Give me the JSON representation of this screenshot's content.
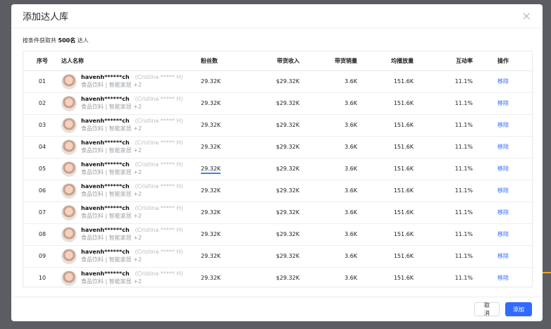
{
  "dialog": {
    "title": "添加达人库",
    "close_glyph": "×",
    "summary_prefix": "按条件获取共",
    "summary_count": "500名",
    "summary_suffix": "达人"
  },
  "table": {
    "headers": {
      "index": "序号",
      "name": "达人名称",
      "followers": "粉丝数",
      "sales_income": "带货收入",
      "sales_volume": "带货销量",
      "avg_plays": "均播放量",
      "engagement": "互动率",
      "action": "操作"
    },
    "rows": [
      {
        "index": "01",
        "handle": "havenh******ch",
        "real_name": "(Cristina ***** H)",
        "tags": "食品饮料 | 智能家居 +2",
        "followers": "29.32K",
        "income": "$29.32K",
        "volume": "3.6K",
        "plays": "151.6K",
        "rate": "11.1%",
        "action": "移除"
      },
      {
        "index": "02",
        "handle": "havenh******ch",
        "real_name": "(Cristina ***** H)",
        "tags": "食品饮料 | 智能家居 +2",
        "followers": "29.32K",
        "income": "$29.32K",
        "volume": "3.6K",
        "plays": "151.6K",
        "rate": "11.1%",
        "action": "移除"
      },
      {
        "index": "03",
        "handle": "havenh******ch",
        "real_name": "(Cristina ***** H)",
        "tags": "食品饮料 | 智能家居 +2",
        "followers": "29.32K",
        "income": "$29.32K",
        "volume": "3.6K",
        "plays": "151.6K",
        "rate": "11.1%",
        "action": "移除"
      },
      {
        "index": "04",
        "handle": "havenh******ch",
        "real_name": "(Cristina ***** H)",
        "tags": "食品饮料 | 智能家居 +2",
        "followers": "29.32K",
        "income": "$29.32K",
        "volume": "3.6K",
        "plays": "151.6K",
        "rate": "11.1%",
        "action": "移除"
      },
      {
        "index": "05",
        "handle": "havenh******ch",
        "real_name": "(Cristina ***** H)",
        "tags": "食品饮料 | 智能家居 +2",
        "followers": "29.32K",
        "income": "$29.32K",
        "volume": "3.6K",
        "plays": "151.6K",
        "rate": "11.1%",
        "action": "移除"
      },
      {
        "index": "06",
        "handle": "havenh******ch",
        "real_name": "(Cristina ***** H)",
        "tags": "食品饮料 | 智能家居 +2",
        "followers": "29.32K",
        "income": "$29.32K",
        "volume": "3.6K",
        "plays": "151.6K",
        "rate": "11.1%",
        "action": "移除"
      },
      {
        "index": "07",
        "handle": "havenh******ch",
        "real_name": "(Cristina ***** H)",
        "tags": "食品饮料 | 智能家居 +2",
        "followers": "29.32K",
        "income": "$29.32K",
        "volume": "3.6K",
        "plays": "151.6K",
        "rate": "11.1%",
        "action": "移除"
      },
      {
        "index": "08",
        "handle": "havenh******ch",
        "real_name": "(Cristina ***** H)",
        "tags": "食品饮料 | 智能家居 +2",
        "followers": "29.32K",
        "income": "$29.32K",
        "volume": "3.6K",
        "plays": "151.6K",
        "rate": "11.1%",
        "action": "移除"
      },
      {
        "index": "09",
        "handle": "havenh******ch",
        "real_name": "(Cristina ***** H)",
        "tags": "食品饮料 | 智能家居 +2",
        "followers": "29.32K",
        "income": "$29.32K",
        "volume": "3.6K",
        "plays": "151.6K",
        "rate": "11.1%",
        "action": "移除"
      },
      {
        "index": "10",
        "handle": "havenh******ch",
        "real_name": "(Cristina ***** H)",
        "tags": "食品饮料 | 智能家居 +2",
        "followers": "29.32K",
        "income": "$29.32K",
        "volume": "3.6K",
        "plays": "151.6K",
        "rate": "11.1%",
        "action": "移除"
      }
    ]
  },
  "footer": {
    "cancel_label": "取消",
    "add_label": "添加"
  },
  "colors": {
    "primary": "#2f6bff",
    "overlay": "#5b5d63"
  }
}
